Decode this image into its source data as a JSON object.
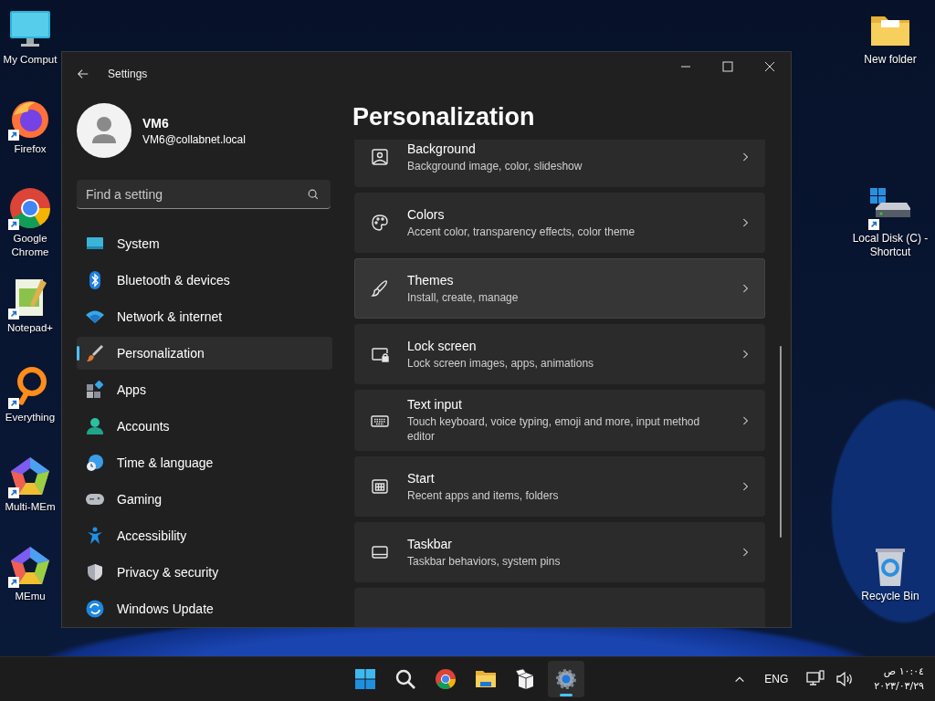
{
  "desktop": {
    "left_icons": [
      {
        "kind": "monitor",
        "label": "My Comput",
        "shortcut": false
      },
      {
        "kind": "firefox",
        "label": "Firefox",
        "shortcut": true
      },
      {
        "kind": "chrome",
        "label": "Google Chrome",
        "shortcut": true
      },
      {
        "kind": "notepad",
        "label": "Notepad+",
        "shortcut": true
      },
      {
        "kind": "everything",
        "label": "Everything",
        "shortcut": true
      },
      {
        "kind": "multimemu",
        "label": "Multi-MEm",
        "shortcut": true
      },
      {
        "kind": "memu",
        "label": "MEmu",
        "shortcut": true
      }
    ],
    "right_icons": [
      {
        "kind": "folder",
        "label": "New folder",
        "shortcut": false
      },
      {
        "kind": "disk",
        "label": "Local Disk (C) - Shortcut",
        "shortcut": true
      },
      {
        "kind": "recycle",
        "label": "Recycle Bin",
        "shortcut": false
      }
    ]
  },
  "window": {
    "title": "Settings",
    "profile": {
      "name": "VM6",
      "email": "VM6@collabnet.local"
    },
    "search": {
      "placeholder": "Find a setting"
    },
    "nav": [
      {
        "kind": "system",
        "label": "System",
        "selected": false
      },
      {
        "kind": "bluetooth",
        "label": "Bluetooth & devices",
        "selected": false
      },
      {
        "kind": "network",
        "label": "Network & internet",
        "selected": false
      },
      {
        "kind": "personalization",
        "label": "Personalization",
        "selected": true
      },
      {
        "kind": "apps",
        "label": "Apps",
        "selected": false
      },
      {
        "kind": "accounts",
        "label": "Accounts",
        "selected": false
      },
      {
        "kind": "time",
        "label": "Time & language",
        "selected": false
      },
      {
        "kind": "gaming",
        "label": "Gaming",
        "selected": false
      },
      {
        "kind": "accessibility",
        "label": "Accessibility",
        "selected": false
      },
      {
        "kind": "privacy",
        "label": "Privacy & security",
        "selected": false
      },
      {
        "kind": "update",
        "label": "Windows Update",
        "selected": false
      }
    ],
    "heading": "Personalization",
    "cards": [
      {
        "kind": "background",
        "title": "Background",
        "subtitle": "Background image, color, slideshow",
        "hovered": false
      },
      {
        "kind": "colors",
        "title": "Colors",
        "subtitle": "Accent color, transparency effects, color theme",
        "hovered": false
      },
      {
        "kind": "themes",
        "title": "Themes",
        "subtitle": "Install, create, manage",
        "hovered": true
      },
      {
        "kind": "lock",
        "title": "Lock screen",
        "subtitle": "Lock screen images, apps, animations",
        "hovered": false
      },
      {
        "kind": "keyboard",
        "title": "Text input",
        "subtitle": "Touch keyboard, voice typing, emoji and more, input method editor",
        "hovered": false
      },
      {
        "kind": "start",
        "title": "Start",
        "subtitle": "Recent apps and items, folders",
        "hovered": false
      },
      {
        "kind": "taskbar",
        "title": "Taskbar",
        "subtitle": "Taskbar behaviors, system pins",
        "hovered": false
      },
      {
        "hovered": false
      }
    ]
  },
  "taskbar": {
    "apps": [
      {
        "kind": "start",
        "active": false
      },
      {
        "kind": "search",
        "active": false
      },
      {
        "kind": "chrome",
        "active": false
      },
      {
        "kind": "explorer",
        "active": false
      },
      {
        "kind": "package",
        "active": false
      },
      {
        "kind": "settings",
        "active": true
      }
    ],
    "language": "ENG",
    "time": "١٠:٠٤ ص",
    "date": "٢٠٢٣/٠٣/٢٩"
  }
}
